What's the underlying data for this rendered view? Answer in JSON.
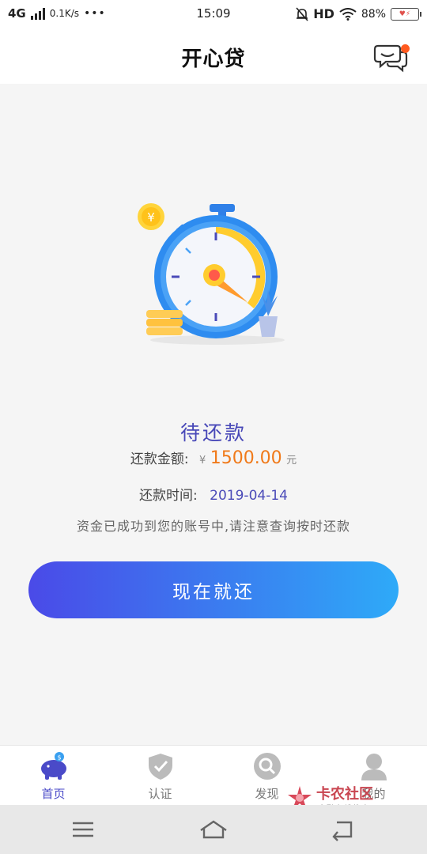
{
  "status_bar": {
    "network": "4G",
    "speed": "0.1K/s",
    "dots": "•••",
    "time": "15:09",
    "hd": "HD",
    "battery": "88%"
  },
  "header": {
    "title": "开心贷",
    "message_icon": "chat-bubble-icon",
    "notification_color": "#ff5a1f"
  },
  "status": {
    "title": "待还款",
    "amount_label": "还款金额:",
    "amount_currency": "¥",
    "amount_value": "1500.00",
    "amount_unit": "元",
    "date_label": "还款时间:",
    "date_value": "2019-04-14",
    "notice": "资金已成功到您的账号中,请注意查询按时还款"
  },
  "repay_button": {
    "label": "现在就还",
    "gradient": [
      "#4a4ae8",
      "#2eaaf8"
    ]
  },
  "tabs": [
    {
      "label": "首页",
      "icon": "piggy-bank-icon",
      "active": true
    },
    {
      "label": "认证",
      "icon": "shield-check-icon",
      "active": false
    },
    {
      "label": "发现",
      "icon": "search-icon",
      "active": false
    },
    {
      "label": "我的",
      "icon": "user-icon",
      "active": false
    }
  ],
  "watermark": {
    "text": "卡农社区",
    "sub": "金融在线教育"
  },
  "colors": {
    "accent": "#4a4ac8",
    "amount": "#f07a1a"
  }
}
